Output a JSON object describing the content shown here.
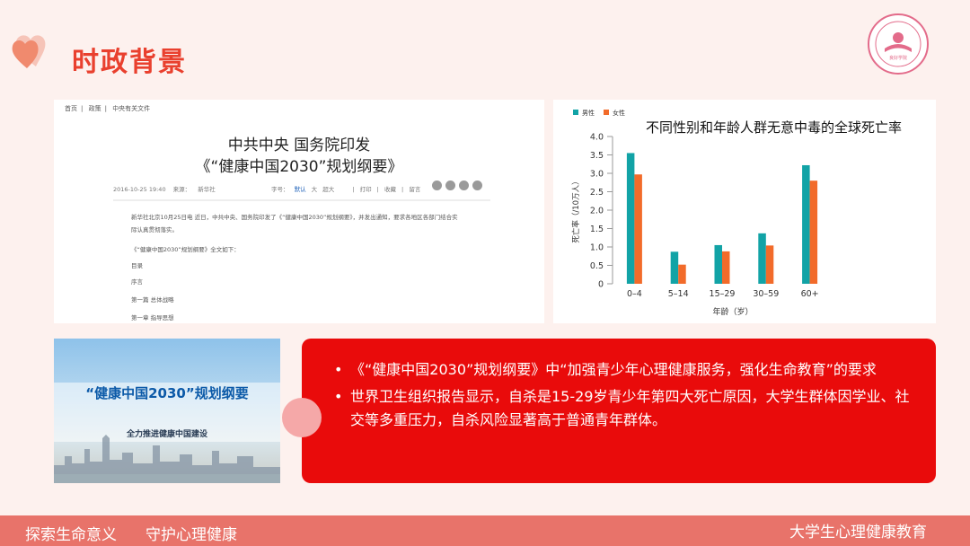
{
  "header": {
    "title": "时政背景"
  },
  "logo": {
    "text": "良好学院"
  },
  "document": {
    "breadcrumbs": [
      "首页",
      "政策",
      "中央有关文件"
    ],
    "title_line1": "中共中央 国务院印发",
    "title_line2": "《“健康中国2030”规划纲要》",
    "meta_date": "2016-10-25 19:40",
    "meta_source": "来源：",
    "meta_publisher": "新华社",
    "meta_fontsize_label": "字号：",
    "meta_font_default": "默认",
    "meta_font_large": "大",
    "meta_font_xlarge": "超大",
    "meta_print": "打印",
    "meta_favorite": "收藏",
    "meta_copy": "留言",
    "para1_line1": "新华社北京10月25日电  近日，中共中央、国务院印发了《“健康中国2030”规划纲要》，并发出通知，要求各地区各部门结合实",
    "para1_line2": "际认真贯彻落实。",
    "para2": "《“健康中国2030”规划纲要》全文如下：",
    "toc": [
      "目录",
      "序言",
      "第一篇  总体战略",
      "第一章  指导思想"
    ]
  },
  "chart_data": {
    "type": "bar",
    "title": "不同性别和年龄人群无意中毒的全球死亡率",
    "categories": [
      "0–4",
      "5–14",
      "15–29",
      "30–59",
      "60+"
    ],
    "series": [
      {
        "name": "男性",
        "values": [
          3.55,
          0.87,
          1.05,
          1.37,
          3.22
        ],
        "color": "#12a3a6"
      },
      {
        "name": "女性",
        "values": [
          2.97,
          0.52,
          0.88,
          1.04,
          2.8
        ],
        "color": "#f26b2a"
      }
    ],
    "ylabel": "死亡率（/10万人）",
    "xlabel": "年龄（岁）",
    "yticks": [
      "0",
      "0.5",
      "1.0",
      "1.5",
      "2.0",
      "2.5",
      "3.0",
      "3.5",
      "4.0"
    ],
    "ylim": [
      0,
      4.0
    ],
    "legend": "top-left",
    "grid": false
  },
  "photo": {
    "title": "“健康中国2030”规划纲要",
    "subtitle": "全力推进健康中国建设"
  },
  "bullets": [
    "《“健康中国2030”规划纲要》中“加强青少年心理健康服务，强化生命教育”的要求",
    "世界卫生组织报告显示，自杀是15-29岁青少年第四大死亡原因，大学生群体因学业、社交等多重压力，自杀风险显著高于普通青年群体。"
  ],
  "footer": {
    "left1": "探索生命意义",
    "left2": "守护心理健康",
    "right": "大学生心理健康教育"
  },
  "colors": {
    "accent": "#e9402e",
    "red_box": "#e90b0b",
    "footer": "#e8736a",
    "male": "#12a3a6",
    "female": "#f26b2a"
  }
}
